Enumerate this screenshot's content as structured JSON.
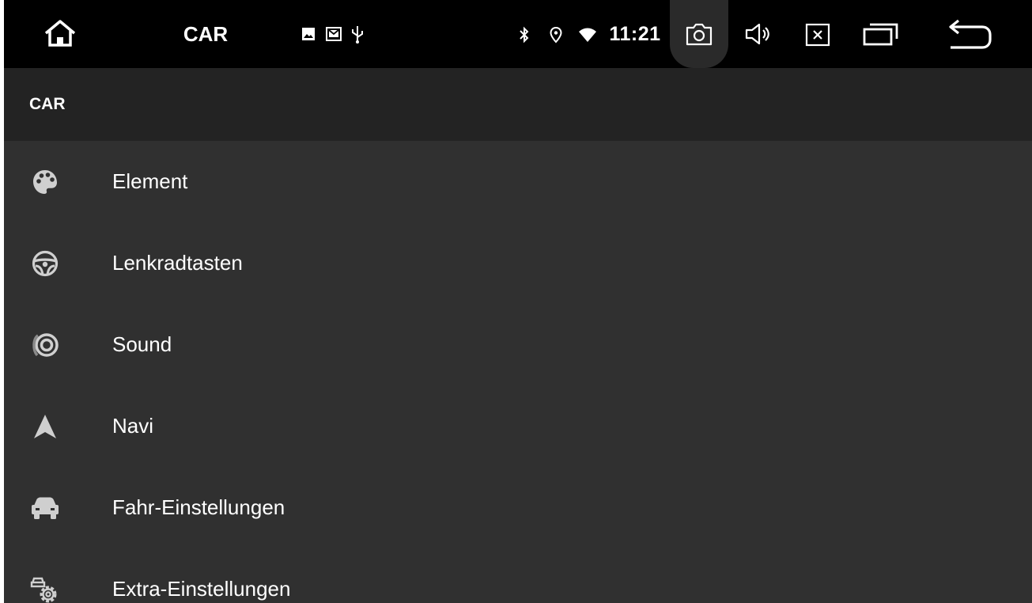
{
  "statusbar": {
    "title": "CAR",
    "time": "11:21",
    "icons": [
      "home-icon",
      "image-notification-icon",
      "mail-notification-icon",
      "usb-icon",
      "bluetooth-icon",
      "location-icon",
      "wifi-icon",
      "screenshot-camera-icon",
      "volume-icon",
      "close-app-icon",
      "recent-apps-icon",
      "back-icon"
    ]
  },
  "appbar": {
    "title": "CAR"
  },
  "menu": {
    "items": [
      {
        "label": "Element",
        "icon": "palette-icon"
      },
      {
        "label": "Lenkradtasten",
        "icon": "steering-wheel-icon"
      },
      {
        "label": "Sound",
        "icon": "speaker-icon"
      },
      {
        "label": "Navi",
        "icon": "navigation-arrow-icon"
      },
      {
        "label": "Fahr-Einstellungen",
        "icon": "car-icon"
      },
      {
        "label": "Extra-Einstellungen",
        "icon": "car-settings-gear-icon"
      }
    ]
  },
  "colors": {
    "statusbar_bg": "#000000",
    "appbar_bg": "#232323",
    "list_bg": "#303030",
    "text": "#ffffff",
    "icon": "#cfcfcf"
  }
}
